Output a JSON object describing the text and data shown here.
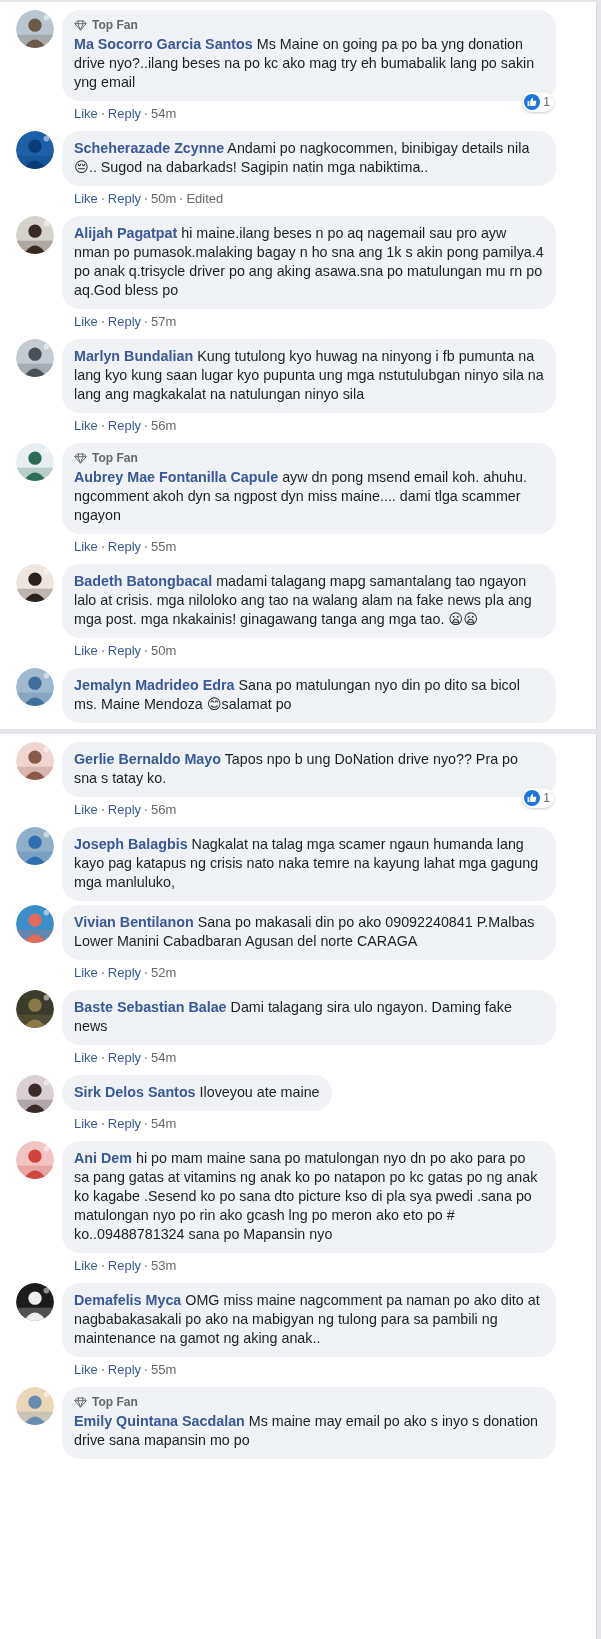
{
  "panels": [
    {
      "comments": [
        {
          "badge": "Top Fan",
          "author": "Ma Socorro Garcia Santos",
          "text": "Ms Maine on going pa po ba yng donation drive nyo?..ilang beses na po kc ako mag try eh bumabalik lang po sakin yng email",
          "like": "Like",
          "reply": "Reply",
          "time": "54m",
          "reactions": "1"
        },
        {
          "author": "Scheherazade Zcynne",
          "text": "Andami po nagkocommen, binibigay details nila 😔.. Sugod na dabarkads! Sagipin natin mga nabiktima..",
          "like": "Like",
          "reply": "Reply",
          "time": "50m",
          "edited": "Edited"
        },
        {
          "author": "Alijah Pagatpat",
          "text": "hi maine.ilang beses n po aq nagemail sau pro ayw nman po pumasok.malaking bagay n ho sna ang 1k s akin pong pamilya.4 po anak q.trisycle driver po ang aking asawa.sna po matulungan mu rn po aq.God bless po",
          "like": "Like",
          "reply": "Reply",
          "time": "57m"
        },
        {
          "author": "Marlyn Bundalian",
          "text": "Kung tutulong kyo huwag na ninyong i fb pumunta na lang kyo kung saan lugar kyo pupunta ung mga nstutulubgan ninyo sila na lang ang magkakalat na natulungan ninyo sila",
          "like": "Like",
          "reply": "Reply",
          "time": "56m"
        },
        {
          "badge": "Top Fan",
          "author": "Aubrey Mae Fontanilla Capule",
          "text": "ayw dn pong msend email koh. ahuhu. ngcomment akoh dyn sa ngpost dyn miss maine.... dami tlga scammer ngayon",
          "like": "Like",
          "reply": "Reply",
          "time": "55m"
        },
        {
          "author": "Badeth Batongbacal",
          "text": "madami talagang mapg samantalang tao ngayon lalo at crisis. mga niloloko ang tao na walang alam na fake news pla ang mga post. mga nkakainis! ginagawang tanga ang mga tao. 😦😦",
          "like": "Like",
          "reply": "Reply",
          "time": "50m"
        },
        {
          "author": "Jemalyn Madrideo Edra",
          "text": "Sana po matulungan nyo din po dito sa bicol ms. Maine Mendoza 😊salamat po"
        }
      ]
    },
    {
      "comments": [
        {
          "author": "Gerlie Bernaldo Mayo",
          "text": "Tapos npo b ung DoNation drive nyo?? Pra po sna s tatay ko.",
          "like": "Like",
          "reply": "Reply",
          "time": "56m",
          "reactions": "1"
        },
        {
          "author": "Joseph Balagbis",
          "text": "Nagkalat na talag mga scamer ngaun humanda lang kayo pag katapus ng crisis nato naka temre na kayung lahat mga gagung mga manluluko,"
        },
        {
          "author": "Vivian Bentilanon",
          "text": "Sana po makasali din po ako 09092240841 P.Malbas Lower Manini Cabadbaran Agusan del norte CARAGA",
          "like": "Like",
          "reply": "Reply",
          "time": "52m"
        },
        {
          "author": "Baste Sebastian Balae",
          "text": "Dami talagang sira ulo ngayon. Daming fake news",
          "like": "Like",
          "reply": "Reply",
          "time": "54m"
        },
        {
          "author": "Sirk Delos Santos",
          "text": "Iloveyou ate maine",
          "like": "Like",
          "reply": "Reply",
          "time": "54m"
        },
        {
          "author": "Ani Dem",
          "text": "hi po mam maine sana po matulongan nyo dn po ako para po sa pang gatas at vitamins ng anak ko po natapon po kc gatas po ng anak ko kagabe .Sesend ko po sana dto picture kso di pla sya pwedi .sana po matulongan nyo po rin ako gcash lng po meron ako eto po # ko..09488781324 sana po Mapansin nyo",
          "like": "Like",
          "reply": "Reply",
          "time": "53m"
        },
        {
          "author": "Demafelis Myca",
          "text": "OMG miss maine nagcomment pa naman po ako dito at nagbabakasakali po ako na mabigyan ng tulong para sa pambili ng maintenance na gamot ng aking anak..",
          "like": "Like",
          "reply": "Reply",
          "time": "55m"
        },
        {
          "badge": "Top Fan",
          "author": "Emily Quintana Sacdalan",
          "text": "Ms maine may email po ako s inyo s donation drive sana mapansin mo po"
        }
      ]
    }
  ]
}
